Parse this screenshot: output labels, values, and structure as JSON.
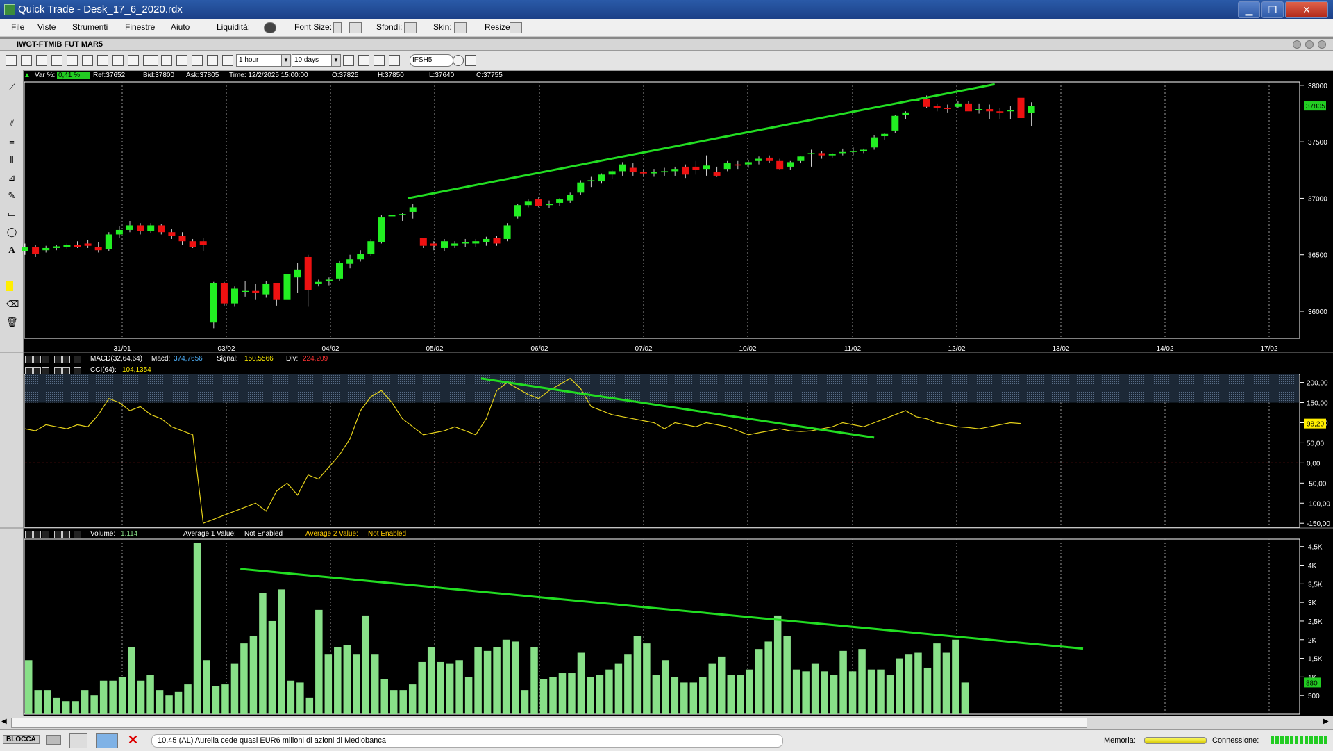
{
  "window": {
    "title": "Quick Trade - Desk_17_6_2020.rdx",
    "minimize": "▁",
    "maximize": "❐",
    "close": "✕"
  },
  "menu": {
    "items": [
      "File",
      "Viste",
      "Strumenti",
      "Finestre",
      "Aiuto"
    ],
    "liquidita_label": "Liquidità:",
    "font_size_label": "Font Size:",
    "sfondi_label": "Sfondi:",
    "skin_label": "Skin:",
    "resize_label": "Resize:"
  },
  "chart_window": {
    "title": "IWGT-FTMIB FUT MAR5",
    "timeframe": "1 hour",
    "period": "10 days",
    "symbol_input": "IFSH5"
  },
  "info": {
    "var_label": "Var %:",
    "var_value": "0,41 %",
    "ref": "Ref:37652",
    "bid": "Bid:37800",
    "ask": "Ask:37805",
    "time": "Time: 12/2/2025 15:00:00",
    "open": "O:37825",
    "high": "H:37850",
    "low": "L:37640",
    "close": "C:37755"
  },
  "price_panel": {
    "y_ticks": [
      "38000",
      "37500",
      "37000",
      "36500",
      "36000"
    ],
    "last_price_tag": "37805",
    "x_labels": [
      "31/01",
      "03/02",
      "04/02",
      "05/02",
      "06/02",
      "07/02",
      "10/02",
      "11/02",
      "12/02",
      "13/02",
      "14/02",
      "17/02"
    ]
  },
  "macd_panel": {
    "label": "MACD(32,64,64)",
    "macd_label": "Macd:",
    "macd_value": "374,7656",
    "signal_label": "Signal:",
    "signal_value": "150,5566",
    "div_label": "Div:",
    "div_value": "224,209"
  },
  "cci_panel": {
    "label": "CCI(64):",
    "value": "104,1354",
    "y_ticks": [
      "200,00",
      "150,00",
      "100,00",
      "50,00",
      "0,00",
      "-50,00",
      "-100,00",
      "-150,00"
    ],
    "last_tag": "98,20"
  },
  "volume_panel": {
    "label": "Volume:",
    "value": "1.114",
    "avg1_label": "Average 1 Value:",
    "avg1_value": "Not Enabled",
    "avg2_label": "Average 2 Value:",
    "avg2_value": "Not Enabled",
    "y_ticks": [
      "4,5K",
      "4K",
      "3,5K",
      "3K",
      "2,5K",
      "2K",
      "1,5K",
      "1K",
      "500"
    ],
    "last_tag": "880"
  },
  "status": {
    "blocca": "BLOCCA",
    "news": "10.45 (AL) Aurelia cede quasi EUR6 milioni di azioni di Mediobanca",
    "memoria_label": "Memoria:",
    "connessione_label": "Connessione:"
  },
  "colors": {
    "up": "#22ee22",
    "down": "#ee1111",
    "trend": "#22dd22",
    "cci_line": "#e6d21a",
    "volume": "#88e088",
    "tag_bg": "#ffee00"
  },
  "chart_data": [
    {
      "type": "candlestick",
      "series": [
        {
          "values": [
            [
              36530,
              36600,
              36500,
              36570
            ],
            [
              36570,
              36590,
              36480,
              36510
            ],
            [
              36540,
              36580,
              36520,
              36560
            ],
            [
              36560,
              36590,
              36540,
              36575
            ],
            [
              36570,
              36600,
              36550,
              36590
            ],
            [
              36590,
              36620,
              36560,
              36570
            ],
            [
              36600,
              36630,
              36560,
              36580
            ],
            [
              36570,
              36610,
              36520,
              36540
            ],
            [
              36550,
              36700,
              36530,
              36680
            ],
            [
              36680,
              36750,
              36650,
              36720
            ],
            [
              36720,
              36800,
              36700,
              36760
            ],
            [
              36760,
              36780,
              36680,
              36710
            ],
            [
              36710,
              36780,
              36690,
              36760
            ],
            [
              36760,
              36770,
              36680,
              36700
            ],
            [
              36700,
              36730,
              36640,
              36670
            ],
            [
              36670,
              36700,
              36590,
              36620
            ],
            [
              36620,
              36640,
              36560,
              36570
            ],
            [
              36620,
              36650,
              36530,
              36590
            ],
            [
              35900,
              36260,
              35850,
              36250
            ],
            [
              36250,
              36260,
              36050,
              36070
            ],
            [
              36070,
              36220,
              36040,
              36200
            ],
            [
              36170,
              36270,
              36130,
              36180
            ],
            [
              36180,
              36240,
              36100,
              36160
            ],
            [
              36150,
              36270,
              36120,
              36240
            ],
            [
              36250,
              36240,
              36050,
              36100
            ],
            [
              36100,
              36350,
              36080,
              36330
            ],
            [
              36300,
              36430,
              36160,
              36370
            ],
            [
              36480,
              36500,
              36040,
              36190
            ],
            [
              36240,
              36280,
              36220,
              36260
            ],
            [
              36270,
              36300,
              36230,
              36280
            ],
            [
              36290,
              36450,
              36270,
              36430
            ],
            [
              36420,
              36500,
              36380,
              36460
            ],
            [
              36460,
              36540,
              36440,
              36510
            ],
            [
              36510,
              36640,
              36490,
              36620
            ],
            [
              36610,
              36850,
              36600,
              36830
            ],
            [
              36840,
              36870,
              36770,
              36850
            ],
            [
              36850,
              36870,
              36800,
              36860
            ],
            [
              36880,
              36950,
              36820,
              36920
            ],
            [
              36650,
              36580,
              36560,
              36580
            ],
            [
              36600,
              36620,
              36540,
              36580
            ],
            [
              36560,
              36640,
              36530,
              36620
            ],
            [
              36580,
              36620,
              36560,
              36600
            ],
            [
              36600,
              36640,
              36570,
              36610
            ],
            [
              36600,
              36640,
              36570,
              36620
            ],
            [
              36610,
              36660,
              36580,
              36640
            ],
            [
              36650,
              36670,
              36580,
              36600
            ],
            [
              36640,
              36780,
              36620,
              36760
            ],
            [
              36840,
              36950,
              36820,
              36940
            ],
            [
              36940,
              36990,
              36920,
              36970
            ],
            [
              36990,
              37010,
              36920,
              36930
            ],
            [
              36940,
              36980,
              36910,
              36950
            ],
            [
              36960,
              37000,
              36930,
              36990
            ],
            [
              36980,
              37050,
              36960,
              37030
            ],
            [
              37050,
              37160,
              37030,
              37140
            ],
            [
              37150,
              37190,
              37100,
              37160
            ],
            [
              37150,
              37220,
              37130,
              37210
            ],
            [
              37210,
              37250,
              37170,
              37240
            ],
            [
              37240,
              37320,
              37200,
              37300
            ],
            [
              37270,
              37310,
              37200,
              37230
            ],
            [
              37230,
              37260,
              37190,
              37220
            ],
            [
              37230,
              37260,
              37190,
              37230
            ],
            [
              37230,
              37270,
              37200,
              37240
            ],
            [
              37240,
              37280,
              37200,
              37260
            ],
            [
              37280,
              37300,
              37180,
              37210
            ],
            [
              37280,
              37330,
              37210,
              37250
            ],
            [
              37260,
              37380,
              37200,
              37290
            ],
            [
              37230,
              37280,
              37190,
              37200
            ],
            [
              37260,
              37330,
              37240,
              37310
            ],
            [
              37300,
              37330,
              37260,
              37290
            ],
            [
              37300,
              37340,
              37270,
              37320
            ],
            [
              37330,
              37370,
              37300,
              37350
            ],
            [
              37360,
              37380,
              37310,
              37330
            ],
            [
              37330,
              37350,
              37250,
              37260
            ],
            [
              37280,
              37330,
              37250,
              37320
            ],
            [
              37330,
              37370,
              37310,
              37370
            ],
            [
              37390,
              37430,
              37280,
              37400
            ],
            [
              37400,
              37420,
              37350,
              37380
            ],
            [
              37380,
              37400,
              37360,
              37390
            ],
            [
              37400,
              37440,
              37380,
              37410
            ],
            [
              37410,
              37450,
              37380,
              37420
            ],
            [
              37430,
              37440,
              37400,
              37430
            ],
            [
              37450,
              37560,
              37430,
              37540
            ],
            [
              37550,
              37580,
              37520,
              37570
            ],
            [
              37600,
              37740,
              37580,
              37730
            ],
            [
              37740,
              37770,
              37700,
              37760
            ],
            [
              37870,
              37890,
              37850,
              37870
            ],
            [
              37880,
              37910,
              37800,
              37810
            ],
            [
              37820,
              37840,
              37770,
              37800
            ],
            [
              37800,
              37830,
              37760,
              37790
            ],
            [
              37810,
              37860,
              37800,
              37840
            ],
            [
              37840,
              37860,
              37780,
              37770
            ],
            [
              37790,
              37840,
              37750,
              37790
            ],
            [
              37790,
              37830,
              37700,
              37770
            ],
            [
              37770,
              37800,
              37700,
              37760
            ],
            [
              37770,
              37820,
              37700,
              37780
            ],
            [
              37890,
              37900,
              37700,
              37710
            ],
            [
              37755,
              37850,
              37640,
              37820
            ]
          ]
        }
      ],
      "ylim": [
        35760,
        38030
      ],
      "trendline": [
        [
          36.5,
          37000
        ],
        [
          92.5,
          38010
        ]
      ]
    },
    {
      "type": "line",
      "series": [
        {
          "name": "CCI(64)",
          "values": [
            85,
            80,
            95,
            90,
            85,
            95,
            90,
            120,
            160,
            150,
            130,
            140,
            120,
            110,
            90,
            80,
            70,
            -150,
            -140,
            -130,
            -120,
            -110,
            -100,
            -120,
            -70,
            -50,
            -80,
            -30,
            -40,
            -10,
            20,
            60,
            130,
            165,
            180,
            150,
            110,
            90,
            70,
            75,
            80,
            90,
            80,
            70,
            110,
            180,
            200,
            185,
            170,
            160,
            180,
            195,
            210,
            185,
            140,
            130,
            120,
            115,
            110,
            105,
            100,
            85,
            100,
            95,
            90,
            100,
            95,
            90,
            80,
            70,
            75,
            80,
            85,
            80,
            78,
            80,
            85,
            90,
            100,
            95,
            90,
            100,
            110,
            120,
            130,
            115,
            110,
            100,
            95,
            90,
            88,
            85,
            90,
            95,
            100,
            98
          ]
        }
      ],
      "ylim": [
        -160,
        220
      ],
      "highlight_band": [
        150,
        220
      ],
      "trendline": [
        [
          43.5,
          210
        ],
        [
          81,
          63
        ]
      ]
    },
    {
      "type": "bar",
      "series": [
        {
          "name": "Volume",
          "values": [
            1450,
            650,
            650,
            450,
            350,
            350,
            650,
            500,
            900,
            900,
            1000,
            1800,
            900,
            1050,
            650,
            500,
            600,
            800,
            4600,
            1450,
            750,
            800,
            1350,
            1900,
            2100,
            3250,
            2500,
            3350,
            900,
            850,
            450,
            2800,
            1600,
            1800,
            1850,
            1600,
            2650,
            1600,
            950,
            650,
            650,
            800,
            1400,
            1800,
            1400,
            1350,
            1450,
            1000,
            1800,
            1700,
            1800,
            2000,
            1950,
            650,
            1800,
            950,
            1000,
            1100,
            1100,
            1650,
            1000,
            1050,
            1200,
            1350,
            1600,
            2100,
            1900,
            1050,
            1450,
            1000,
            850,
            850,
            1000,
            1350,
            1550,
            1050,
            1050,
            1200,
            1750,
            1950,
            2650,
            2100,
            1200,
            1150,
            1350,
            1150,
            1050,
            1700,
            1150,
            1750,
            1200,
            1200,
            1050,
            1500,
            1600,
            1650,
            1250,
            1900,
            1650,
            2000,
            850
          ]
        }
      ],
      "ylim": [
        0,
        4700
      ],
      "trendline": [
        [
          23,
          3900
        ],
        [
          113,
          1760
        ]
      ]
    }
  ]
}
